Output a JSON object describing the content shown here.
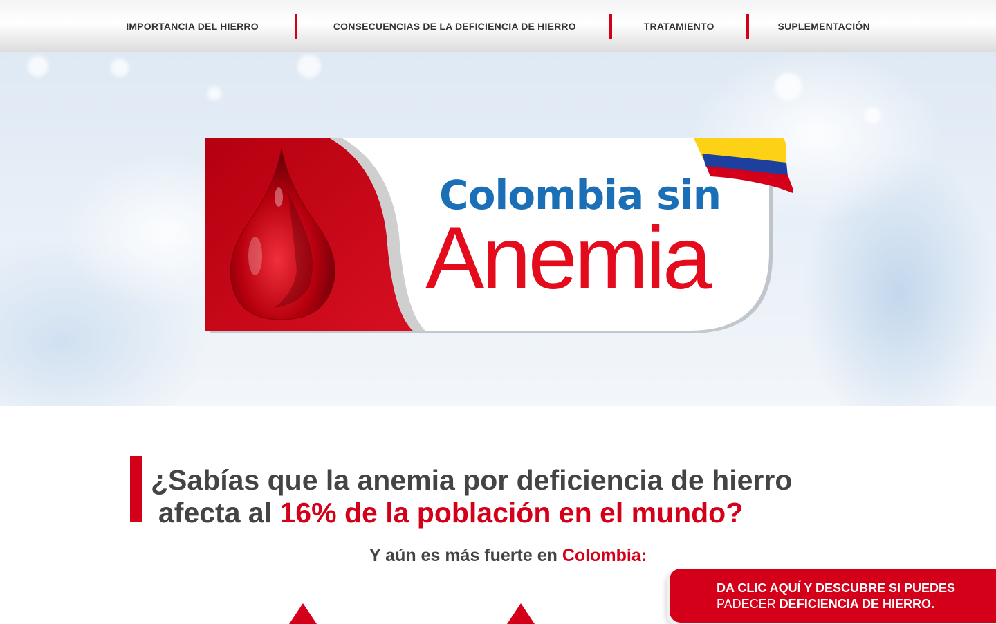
{
  "nav": {
    "items": [
      {
        "label": "IMPORTANCIA DEL HIERRO"
      },
      {
        "label": "CONSECUENCIAS DE LA DEFICIENCIA DE HIERRO"
      },
      {
        "label": "TRATAMIENTO"
      },
      {
        "label": "SUPLEMENTACIÓN"
      }
    ],
    "separator_color": "#d4001a"
  },
  "hero": {
    "logo": {
      "line1": "Colombia sin",
      "line2": "Anemia",
      "colors": {
        "blue": "#1a6fb7",
        "red": "#e30b1c"
      },
      "icons": [
        "blood-drop-icon",
        "colombia-flag-icon"
      ]
    }
  },
  "main": {
    "question": {
      "line1": "¿Sabías que la anemia por deficiencia de hierro",
      "line2_prefix": "afecta al ",
      "line2_highlight": "16% de la población en el mundo?"
    },
    "subheading": {
      "prefix": "Y aún es más fuerte en ",
      "highlight": "Colombia:"
    }
  },
  "cta": {
    "line1": "DA CLIC AQUÍ Y DESCUBRE SI PUEDES",
    "line2_prefix": "PADECER ",
    "line2_highlight": "DEFICIENCIA DE HIERRO."
  }
}
